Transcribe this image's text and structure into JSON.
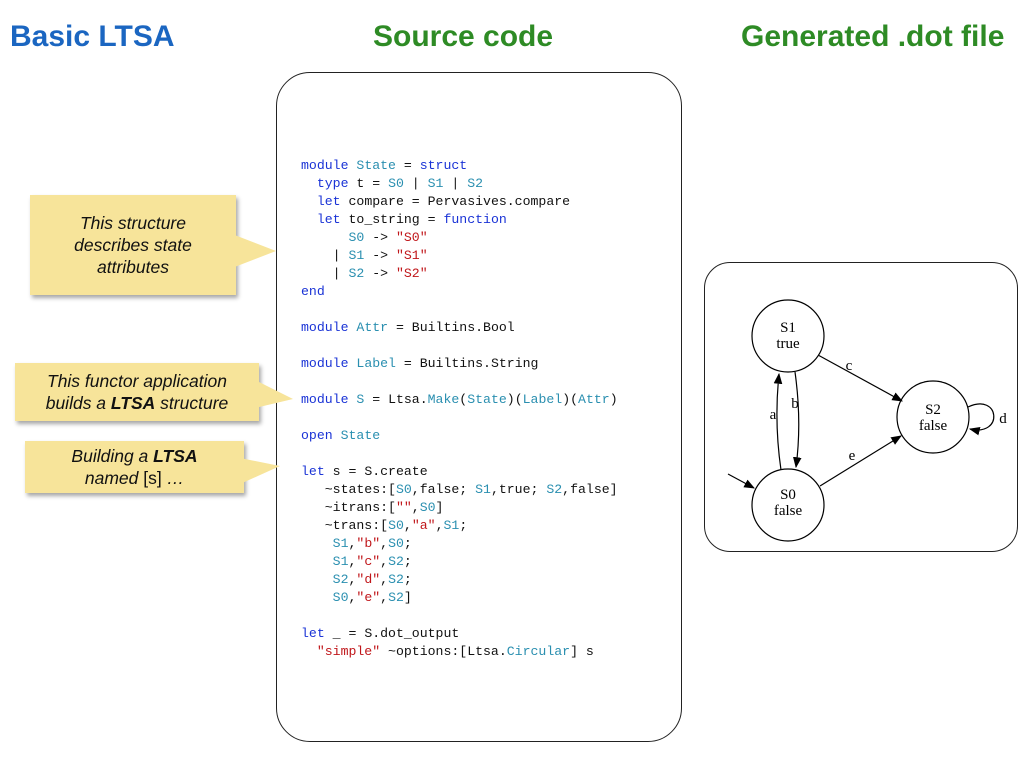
{
  "headings": {
    "main": "Basic LTSA",
    "source": "Source code",
    "generated": "Generated .dot file"
  },
  "notes": [
    {
      "lines": [
        [
          {
            "t": "This structure"
          }
        ],
        [
          {
            "t": "describes state"
          }
        ],
        [
          {
            "t": "attributes"
          }
        ]
      ]
    },
    {
      "lines": [
        [
          {
            "t": "This functor application"
          }
        ],
        [
          {
            "t": "builds a "
          },
          {
            "t": "LTSA",
            "b": true
          },
          {
            "t": " structure"
          }
        ]
      ]
    },
    {
      "lines": [
        [
          {
            "t": "Building a "
          },
          {
            "t": "LTSA",
            "b": true
          }
        ],
        [
          {
            "t": "named "
          },
          {
            "t": "[s]",
            "n": true
          },
          {
            "t": " …"
          }
        ]
      ]
    }
  ],
  "code": [
    [
      [
        "kw",
        "module"
      ],
      [
        "pl",
        " "
      ],
      [
        "md",
        "State"
      ],
      [
        "pl",
        " = "
      ],
      [
        "kw",
        "struct"
      ]
    ],
    [
      [
        "pl",
        "  "
      ],
      [
        "kw",
        "type"
      ],
      [
        "pl",
        " t = "
      ],
      [
        "md",
        "S0"
      ],
      [
        "pl",
        " | "
      ],
      [
        "md",
        "S1"
      ],
      [
        "pl",
        " | "
      ],
      [
        "md",
        "S2"
      ]
    ],
    [
      [
        "pl",
        "  "
      ],
      [
        "kw",
        "let"
      ],
      [
        "pl",
        " compare = Pervasives.compare"
      ]
    ],
    [
      [
        "pl",
        "  "
      ],
      [
        "kw",
        "let"
      ],
      [
        "pl",
        " to_string = "
      ],
      [
        "kw",
        "function"
      ]
    ],
    [
      [
        "pl",
        "      "
      ],
      [
        "md",
        "S0"
      ],
      [
        "pl",
        " -> "
      ],
      [
        "st",
        "\"S0\""
      ]
    ],
    [
      [
        "pl",
        "    | "
      ],
      [
        "md",
        "S1"
      ],
      [
        "pl",
        " -> "
      ],
      [
        "st",
        "\"S1\""
      ]
    ],
    [
      [
        "pl",
        "    | "
      ],
      [
        "md",
        "S2"
      ],
      [
        "pl",
        " -> "
      ],
      [
        "st",
        "\"S2\""
      ]
    ],
    [
      [
        "kw",
        "end"
      ]
    ],
    [],
    [
      [
        "kw",
        "module"
      ],
      [
        "pl",
        " "
      ],
      [
        "md",
        "Attr"
      ],
      [
        "pl",
        " = Builtins.Bool"
      ]
    ],
    [],
    [
      [
        "kw",
        "module"
      ],
      [
        "pl",
        " "
      ],
      [
        "md",
        "Label"
      ],
      [
        "pl",
        " = Builtins.String"
      ]
    ],
    [],
    [
      [
        "kw",
        "module"
      ],
      [
        "pl",
        " "
      ],
      [
        "md",
        "S"
      ],
      [
        "pl",
        " = Ltsa."
      ],
      [
        "md",
        "Make"
      ],
      [
        "pl",
        "("
      ],
      [
        "md",
        "State"
      ],
      [
        "pl",
        ")("
      ],
      [
        "md",
        "Label"
      ],
      [
        "pl",
        ")("
      ],
      [
        "md",
        "Attr"
      ],
      [
        "pl",
        ")"
      ]
    ],
    [],
    [
      [
        "kw",
        "open"
      ],
      [
        "pl",
        " "
      ],
      [
        "md",
        "State"
      ]
    ],
    [],
    [
      [
        "kw",
        "let"
      ],
      [
        "pl",
        " s = S.create"
      ]
    ],
    [
      [
        "pl",
        "   ~states:["
      ],
      [
        "md",
        "S0"
      ],
      [
        "pl",
        ",false; "
      ],
      [
        "md",
        "S1"
      ],
      [
        "pl",
        ",true; "
      ],
      [
        "md",
        "S2"
      ],
      [
        "pl",
        ",false]"
      ]
    ],
    [
      [
        "pl",
        "   ~itrans:["
      ],
      [
        "st",
        "\"\""
      ],
      [
        "pl",
        ","
      ],
      [
        "md",
        "S0"
      ],
      [
        "pl",
        "]"
      ]
    ],
    [
      [
        "pl",
        "   ~trans:["
      ],
      [
        "md",
        "S0"
      ],
      [
        "pl",
        ","
      ],
      [
        "st",
        "\"a\""
      ],
      [
        "pl",
        ","
      ],
      [
        "md",
        "S1"
      ],
      [
        "pl",
        ";"
      ]
    ],
    [
      [
        "pl",
        "    "
      ],
      [
        "md",
        "S1"
      ],
      [
        "pl",
        ","
      ],
      [
        "st",
        "\"b\""
      ],
      [
        "pl",
        ","
      ],
      [
        "md",
        "S0"
      ],
      [
        "pl",
        ";"
      ]
    ],
    [
      [
        "pl",
        "    "
      ],
      [
        "md",
        "S1"
      ],
      [
        "pl",
        ","
      ],
      [
        "st",
        "\"c\""
      ],
      [
        "pl",
        ","
      ],
      [
        "md",
        "S2"
      ],
      [
        "pl",
        ";"
      ]
    ],
    [
      [
        "pl",
        "    "
      ],
      [
        "md",
        "S2"
      ],
      [
        "pl",
        ","
      ],
      [
        "st",
        "\"d\""
      ],
      [
        "pl",
        ","
      ],
      [
        "md",
        "S2"
      ],
      [
        "pl",
        ";"
      ]
    ],
    [
      [
        "pl",
        "    "
      ],
      [
        "md",
        "S0"
      ],
      [
        "pl",
        ","
      ],
      [
        "st",
        "\"e\""
      ],
      [
        "pl",
        ","
      ],
      [
        "md",
        "S2"
      ],
      [
        "pl",
        "]"
      ]
    ],
    [],
    [
      [
        "kw",
        "let"
      ],
      [
        "pl",
        " _ = S.dot_output"
      ]
    ],
    [
      [
        "pl",
        "  "
      ],
      [
        "st",
        "\"simple\""
      ],
      [
        "pl",
        " ~options:[Ltsa."
      ],
      [
        "md",
        "Circular"
      ],
      [
        "pl",
        "] s"
      ]
    ]
  ],
  "graph": {
    "nodes": [
      {
        "id": "S1",
        "name": "S1",
        "attr": "true"
      },
      {
        "id": "S0",
        "name": "S0",
        "attr": "false"
      },
      {
        "id": "S2",
        "name": "S2",
        "attr": "false"
      }
    ],
    "edges": [
      {
        "label": "a"
      },
      {
        "label": "b"
      },
      {
        "label": "c"
      },
      {
        "label": "d"
      },
      {
        "label": "e"
      }
    ]
  },
  "colors": {
    "heading_main": "#1b66c1",
    "heading_section": "#2e8b25",
    "keyword": "#1a33d6",
    "module": "#2a8fb0",
    "string": "#c0161a",
    "note_bg": "#f7e49a"
  }
}
